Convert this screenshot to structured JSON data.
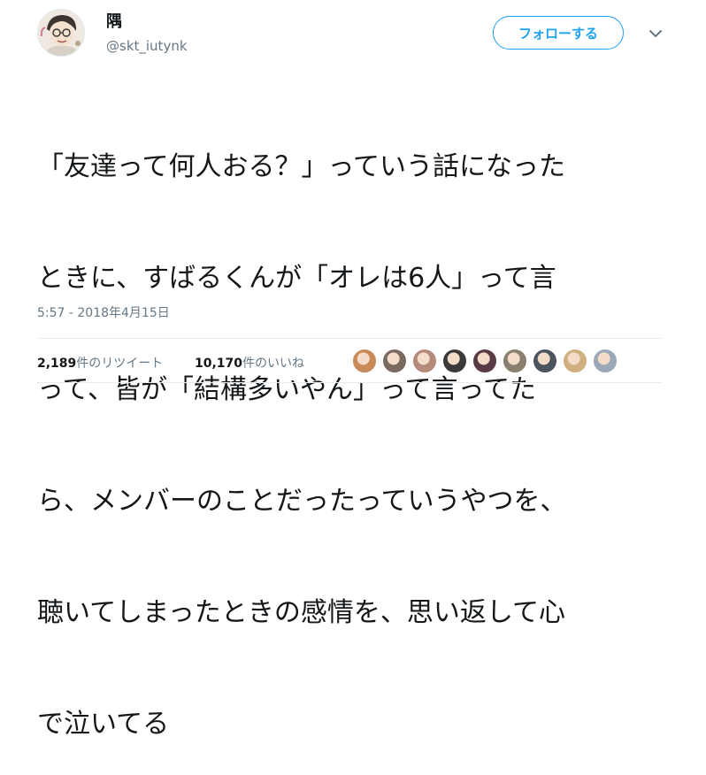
{
  "user": {
    "display_name": "隅",
    "handle": "@skt_iutynk"
  },
  "actions": {
    "follow_label": "フォローする"
  },
  "tweet": {
    "lines": [
      "「友達って何人おる？」っていう話になった",
      "ときに、すばるくんが「オレは6人」って言",
      "って、皆が「結構多いやん」って言ってた",
      "ら、メンバーのことだったっていうやつを、",
      "聴いてしまったときの感情を、思い返して心",
      "で泣いてる"
    ],
    "timestamp": "5:57 - 2018年4月15日"
  },
  "stats": {
    "retweets_count": "2,189",
    "retweets_label": "件のリツイート",
    "likes_count": "10,170",
    "likes_label": "件のいいね"
  },
  "likers": [
    {
      "name": "liker-avatar-1",
      "color": "#c98a5a"
    },
    {
      "name": "liker-avatar-2",
      "color": "#7a6a60"
    },
    {
      "name": "liker-avatar-3",
      "color": "#b58a7a"
    },
    {
      "name": "liker-avatar-4",
      "color": "#3a3a3a"
    },
    {
      "name": "liker-avatar-5",
      "color": "#5a3b45"
    },
    {
      "name": "liker-avatar-6",
      "color": "#8a8070"
    },
    {
      "name": "liker-avatar-7",
      "color": "#4a5560"
    },
    {
      "name": "liker-avatar-8",
      "color": "#d0b080"
    },
    {
      "name": "liker-avatar-9",
      "color": "#9aa8b8"
    }
  ],
  "colors": {
    "accent": "#1da1f2",
    "text": "#14171a",
    "secondary": "#657786"
  }
}
